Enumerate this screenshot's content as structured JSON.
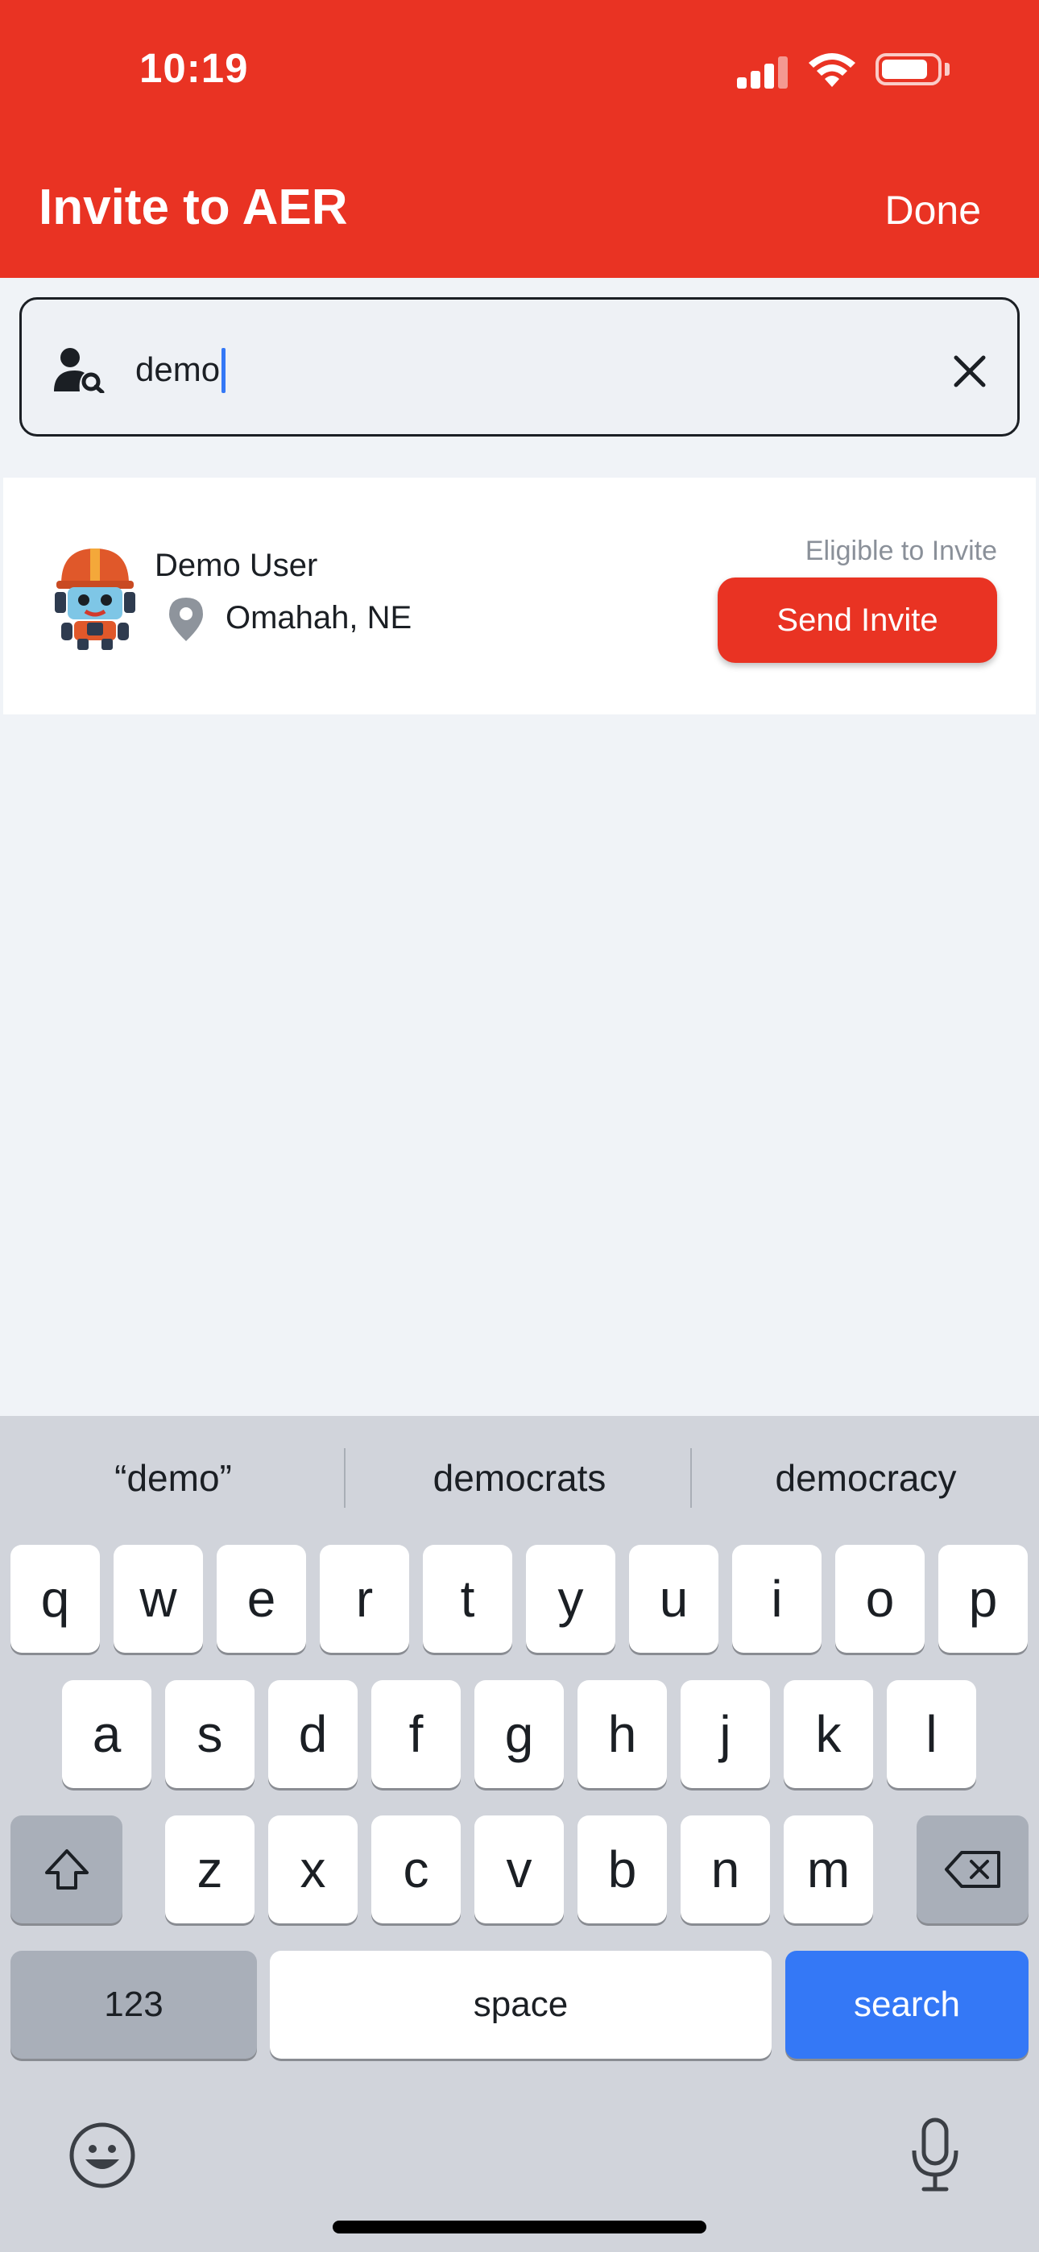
{
  "status_bar": {
    "time": "10:19"
  },
  "header": {
    "title": "Invite to AER",
    "done_label": "Done"
  },
  "search": {
    "value": "demo",
    "placeholder": ""
  },
  "results": [
    {
      "name": "Demo User",
      "location": "Omahah, NE",
      "eligibility": "Eligible to Invite",
      "action_label": "Send Invite"
    }
  ],
  "keyboard": {
    "suggestions": [
      "“demo”",
      "democrats",
      "democracy"
    ],
    "row1": [
      "q",
      "w",
      "e",
      "r",
      "t",
      "y",
      "u",
      "i",
      "o",
      "p"
    ],
    "row2": [
      "a",
      "s",
      "d",
      "f",
      "g",
      "h",
      "j",
      "k",
      "l"
    ],
    "row3": [
      "z",
      "x",
      "c",
      "v",
      "b",
      "n",
      "m"
    ],
    "numbers_label": "123",
    "space_label": "space",
    "search_label": "search"
  },
  "colors": {
    "brand_red": "#e93323",
    "keyboard_blue": "#3478f6"
  }
}
